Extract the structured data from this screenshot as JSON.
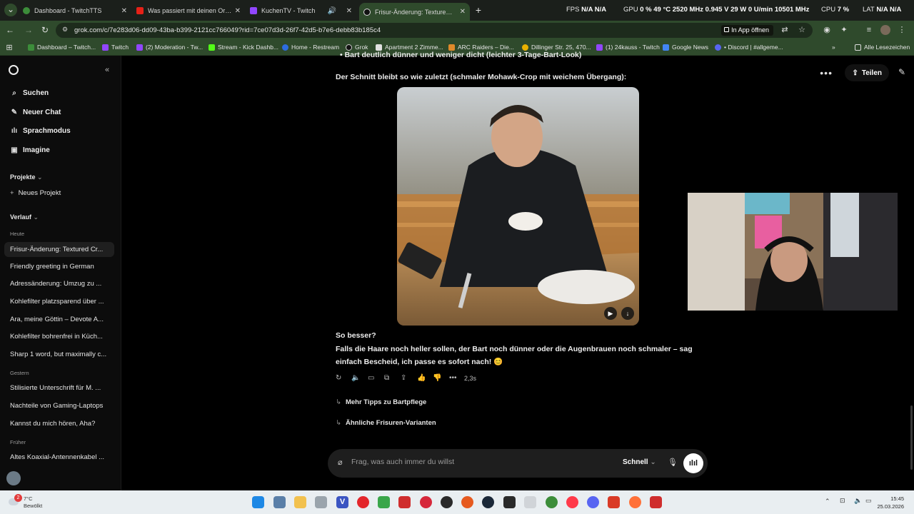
{
  "browser": {
    "tabs": [
      {
        "label": "Dashboard - TwitchTTS",
        "active": false
      },
      {
        "label": "Was passiert mit deinen Organen",
        "active": false
      },
      {
        "label": "KuchenTV - Twitch",
        "active": false
      },
      {
        "label": "Frisur-Änderung: Textured Crop",
        "active": true
      }
    ],
    "url": "grok.com/c/7e283d06-dd09-43ba-b399-2121cc766049?rid=7ce07d3d-26f7-42d5-b7e6-debb83b185c4",
    "open_in_app": "In App öffnen",
    "bookmarks": [
      "Dashboard – Twitch...",
      "Twitch",
      "(2) Moderation - Tw...",
      "Stream - Kick Dashb...",
      "Home - Restream",
      "Grok",
      "Apartment 2 Zimme...",
      "ARC Raiders – Die...",
      "Dillinger Str. 25, 470...",
      "(1) 24kauss - Twitch",
      "Google News",
      "• Discord | #allgeme..."
    ],
    "all_bookmarks": "Alle Lesezeichen"
  },
  "osd": {
    "fps_label": "FPS",
    "fps_val": "N/A N/A",
    "gpu_label": "GPU",
    "gpu_val": "0 % 49 °C 2520 MHz 0.945 V 29 W 0 U/min 10501 MHz",
    "cpu_label": "CPU",
    "cpu_val": "7 %",
    "lat_label": "LAT",
    "lat_val": "N/A N/A"
  },
  "sidebar": {
    "nav": [
      {
        "label": "Suchen",
        "icon": "search-icon"
      },
      {
        "label": "Neuer Chat",
        "icon": "compose-icon"
      },
      {
        "label": "Sprachmodus",
        "icon": "waveform-icon"
      },
      {
        "label": "Imagine",
        "icon": "image-icon"
      }
    ],
    "projects_label": "Projekte",
    "new_project": "Neues Projekt",
    "history_label": "Verlauf",
    "groups": {
      "today": "Heute",
      "yesterday": "Gestern",
      "earlier": "Früher"
    },
    "today_items": [
      "Frisur-Änderung: Textured Cr...",
      "Friendly greeting in German",
      "Adressänderung: Umzug zu ...",
      "Kohlefilter platzsparend über ...",
      "Ara, meine Göttin – Devote A...",
      "Kohlefilter bohrenfrei in Küch...",
      "Sharp 1 word, but maximally c..."
    ],
    "yesterday_items": [
      "Stilisierte Unterschrift für M. ...",
      "Nachteile von Gaming-Laptops",
      "Kannst du mich hören, Aha?"
    ],
    "earlier_items": [
      "Altes Koaxial-Antennenkabel ..."
    ]
  },
  "header": {
    "share_label": "Teilen"
  },
  "chat": {
    "partial_line": "Bart deutlich dünner und weniger dicht (leichter 3-Tage-Bart-Look)",
    "intro": "Der Schnitt bleibt so wie zuletzt (schmaler Mohawk-Crop mit weichem Übergang):",
    "question": "So besser?",
    "body": "Falls die Haare noch heller sollen, der Bart noch dünner oder die Augenbrauen noch schmaler – sag einfach Bescheid, ich passe es sofort nach! 😊",
    "time": "2,3s",
    "suggestions": [
      "Mehr Tipps zu Bartpflege",
      "Ähnliche Frisuren-Varianten"
    ]
  },
  "composer": {
    "placeholder": "Frag, was auch immer du willst",
    "mode": "Schnell"
  },
  "taskbar": {
    "weather_temp": "7°C",
    "weather_desc": "Bewölkt",
    "badge": "2",
    "time": "15:45",
    "date": "25.03.2026"
  }
}
